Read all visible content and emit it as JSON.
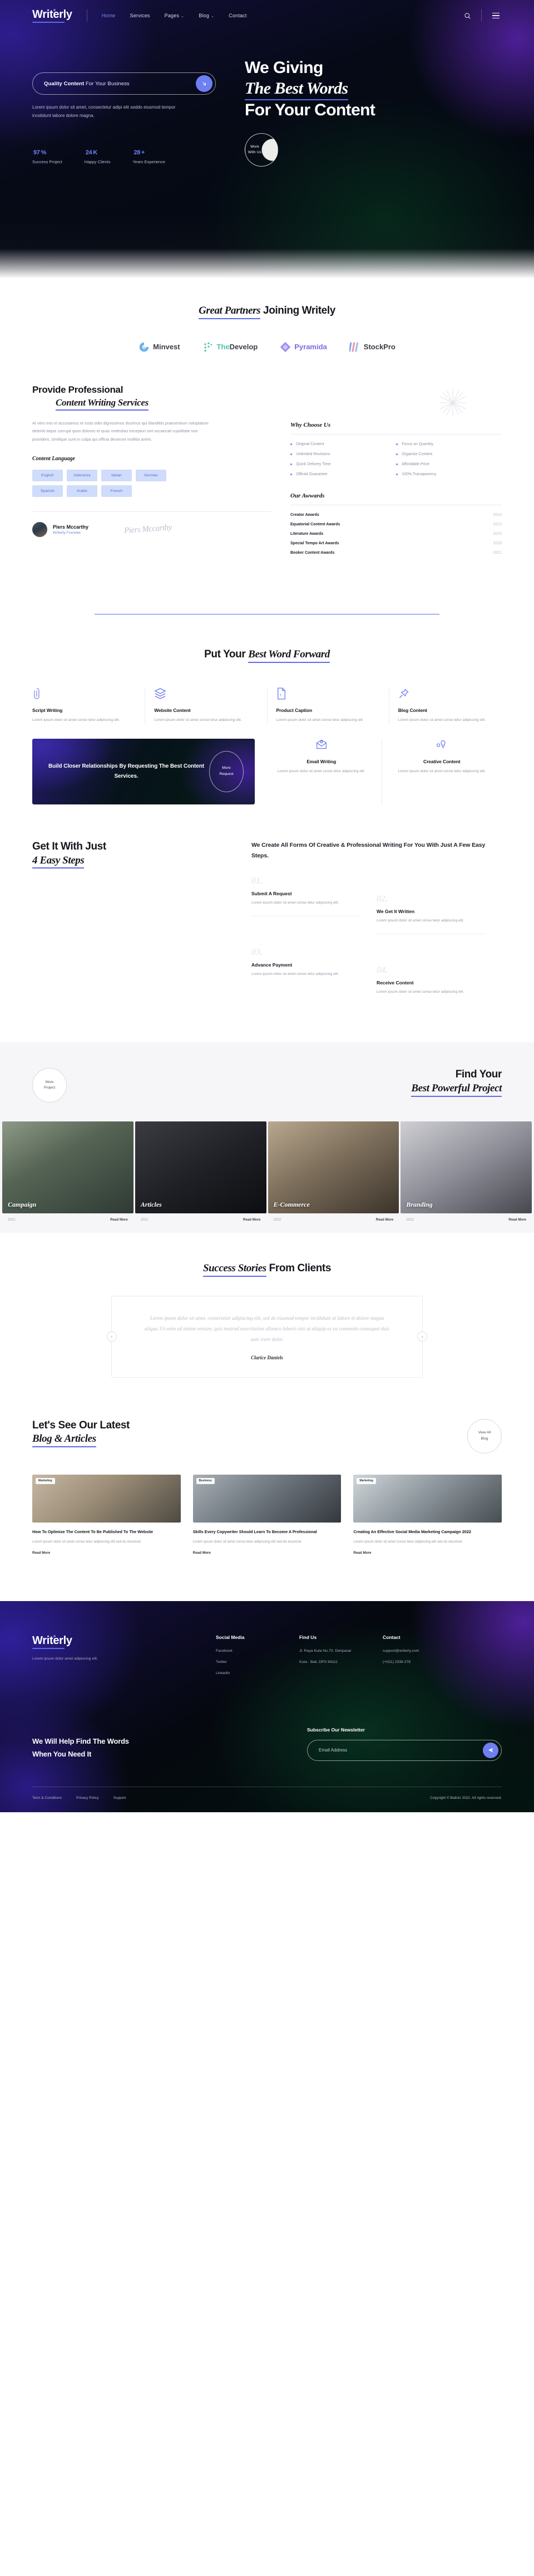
{
  "brand": {
    "name": "Writerly"
  },
  "nav": {
    "items": [
      {
        "label": "Home",
        "active": true
      },
      {
        "label": "Services",
        "active": false
      },
      {
        "label": "Pages",
        "active": false,
        "caret": "⌄"
      },
      {
        "label": "Blog",
        "active": false,
        "caret": "⌄"
      },
      {
        "label": "Contact",
        "active": false
      }
    ],
    "search_icon": "search-icon",
    "menu_icon": "hamburger-icon"
  },
  "hero": {
    "search_strong": "Quality Content",
    "search_rest": " For Your Business",
    "search_button_icon": "arrow-down-right",
    "subtext": "Lorem ipsum dolor sit amet, consectetur adipi elit seddo eiusmod tempor incididunt labore dolore magna.",
    "title_line1": "We Giving",
    "title_line2": "The Best Words",
    "title_line3": "For Your Content",
    "badge": "Work\nWith Us",
    "badge_line1": "Work",
    "badge_line2": "With Us",
    "stats": [
      {
        "value": "97",
        "unit": "%",
        "label": "Success Project"
      },
      {
        "value": "24",
        "unit": "K",
        "label": "Happy Clients"
      },
      {
        "value": "28",
        "unit": "+",
        "label": "Years Experience"
      }
    ]
  },
  "partners": {
    "title_em": "Great Partners",
    "title_rest": " Joining Writely",
    "logos": [
      {
        "name": "Minvest",
        "color": "#5a9fe0"
      },
      {
        "name": "TheDevelop",
        "color": "#4ec5b0"
      },
      {
        "name": "Pyramida",
        "color": "#9a8df0"
      },
      {
        "name": "StockPro",
        "color": "#8fa6e8"
      }
    ]
  },
  "intro": {
    "title_line1": "Provide Professional",
    "title_line2": "Content Writing Services",
    "paragraph": "At vero eos et accusamus et iusto odio dignissimos ducimus qui blanditiis praesentium voluptatum deleniti atque corrupti quos dolores et quas molestias excepturi sint occaecati cupiditate non provident, similique sunt in culpa qui officia deserunt mollitia animi.",
    "lang_heading": "Content Language",
    "languages": [
      "English",
      "Indonesia",
      "Italian",
      "German",
      "Spanish",
      "Arabic",
      "French"
    ],
    "author_name": "Piers Mccarthy",
    "author_role": "Writerly Founder",
    "signature": "Piers Mccarthy"
  },
  "why": {
    "heading": "Why Choose Us",
    "col1": [
      "Original Content",
      "Unlimited Revisions",
      "Quick Delivery Time",
      "Official Guarantee"
    ],
    "col2": [
      "Focus on Quantity",
      "Organize Content",
      "Affordable Price",
      "100% Transparency"
    ]
  },
  "awards": {
    "heading": "Our Awwards",
    "rows": [
      {
        "name": "Creator Awards",
        "year": "2010"
      },
      {
        "name": "Equatorial Content Awards",
        "year": "2012"
      },
      {
        "name": "Literature Awards",
        "year": "2015"
      },
      {
        "name": "Special Tempo Art Awards",
        "year": "2018"
      },
      {
        "name": "Booker Content Awards",
        "year": "2021"
      }
    ]
  },
  "bwf": {
    "title_plain": "Put Your ",
    "title_em": "Best Word Forward",
    "services_row1": [
      {
        "icon": "paperclip-icon",
        "title": "Script Writing",
        "desc": "Lorem ipsum dolor sit amet conse tetur adipiscing elit."
      },
      {
        "icon": "layers-icon",
        "title": "Website Content",
        "desc": "Lorem ipsum dolor sit amet conse tetur adipiscing elit."
      },
      {
        "icon": "document-euro-icon",
        "title": "Product Caption",
        "desc": "Lorem ipsum dolor sit amet conse tetur adipiscing elit."
      },
      {
        "icon": "pushpin-icon",
        "title": "Blog Content",
        "desc": "Lorem ipsum dolor sit amet conse tetur adipiscing elit."
      }
    ],
    "promo": {
      "title": "Build Closer Relationships By Requesting The Best Content Services.",
      "button_line1": "More",
      "button_line2": "Request"
    },
    "services_row2": [
      {
        "icon": "email-icon",
        "title": "Email Writing",
        "desc": "Lorem ipsum dolor sit amet conse tetur adipiscing elit."
      },
      {
        "icon": "lightbulb-icon",
        "title": "Creative Content",
        "desc": "Lorem ipsum dolor sit amet conse tetur adipiscing elit."
      }
    ]
  },
  "steps": {
    "title_line1": "Get It With Just",
    "title_line2": "4 Easy Steps",
    "lead": "We Create All Forms Of Creative & Professional Writing For You With Just A Few Easy Steps.",
    "items": [
      {
        "num": "01.",
        "title": "Submit A Request",
        "desc": "Lorem ipsum dolor sit amet conse tetur adipiscing elit."
      },
      {
        "num": "02.",
        "title": "We Get It Written",
        "desc": "Lorem ipsum dolor sit amet conse tetur adipiscing elit."
      },
      {
        "num": "03.",
        "title": "Advance Payment",
        "desc": "Lorem ipsum dolor sit amet conse tetur adipiscing elit."
      },
      {
        "num": "04.",
        "title": "Receive Content",
        "desc": "Lorem ipsum dolor sit amet conse tetur adipiscing elit."
      }
    ]
  },
  "projects": {
    "more_line1": "More",
    "more_line2": "Project",
    "title_line1": "Find Your",
    "title_line2": "Best Powerful Project",
    "cards": [
      {
        "caption": "Campaign",
        "year": "2021",
        "read_more": "Read More"
      },
      {
        "caption": "Articles",
        "year": "2021",
        "read_more": "Read More"
      },
      {
        "caption": "E-Commerce",
        "year": "2022",
        "read_more": "Read More"
      },
      {
        "caption": "Branding",
        "year": "2022",
        "read_more": "Read More"
      }
    ]
  },
  "testimonial": {
    "title_em": "Success Stories",
    "title_rest": " From Clients",
    "quote": "Lorem ipsum dolor sit amet, consectetur adipiscing elit, sed do eiusmod tempor incididunt ut labore et dolore magna aliqua. Ut enim ad minim veniam, quis nostrud exercitation ullamco laboris nisi ut aliquip ex ea commodo consequat duis aute irure dolor.",
    "author": "Clarice Daniels",
    "prev_icon": "chevron-left-icon",
    "next_icon": "chevron-right-icon"
  },
  "blog": {
    "title_line1": "Let's See Our Latest",
    "title_line2": "Blog & Articles",
    "view_all_line1": "View All",
    "view_all_line2": "Blog",
    "posts": [
      {
        "tag": "Marketing",
        "title": "How To Optimize The Content To Be Published To The Website",
        "desc": "Lorem ipsum dolor sit amet conse tetur adipiscing elit sed do eiusmod.",
        "read_more": "Read More"
      },
      {
        "tag": "Business",
        "title": "Skills Every Copywriter Should Learn To Become A Professional",
        "desc": "Lorem ipsum dolor sit amet conse tetur adipiscing elit sed do eiusmod.",
        "read_more": "Read More"
      },
      {
        "tag": "Marketing",
        "title": "Creating An Effective Social Media Marketing Campaign 2022",
        "desc": "Lorem ipsum dolor sit amet conse tetur adipiscing elit sed do eiusmod.",
        "read_more": "Read More"
      }
    ]
  },
  "footer": {
    "tagline": "Lorem ipsum dolor amet adipiscing elit.",
    "social": {
      "heading": "Social Media",
      "items": [
        "Facebook",
        "Twitter",
        "Linkedin"
      ]
    },
    "find_us": {
      "heading": "Find Us",
      "lines": [
        "Jl. Raya Kuta No.70, Denpasar",
        "Kuta - Bali, DPS 94111"
      ]
    },
    "contact": {
      "heading": "Contact",
      "lines": [
        "support@writerly.com",
        "(+021) 2336 278"
      ]
    },
    "cta_line1": "We Will Help Find The Words",
    "cta_line2": "When You Need It",
    "newsletter": {
      "heading": "Subscribe Our Newsletter",
      "placeholder": "Email Address",
      "value": "",
      "send_icon": "send-icon"
    },
    "bottom_links": [
      "Term & Conditions",
      "Privacy Policy",
      "Support"
    ],
    "copyright": "Copyright © Baliniz 2022. All rights reserved."
  },
  "colors": {
    "accent": "#5d6ce8",
    "accent_soft": "#6d7ff2",
    "chip_bg": "#cfdcfb",
    "chip_text": "#4a6bc4",
    "dark": "#05080f"
  }
}
